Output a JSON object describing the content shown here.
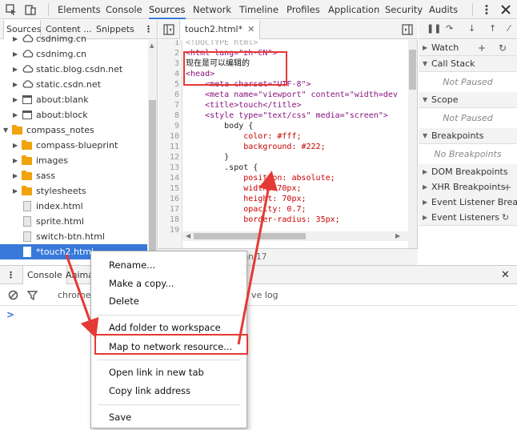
{
  "toolbar": {
    "tabs": [
      "Elements",
      "Console",
      "Sources",
      "Network",
      "Timeline",
      "Profiles",
      "Application",
      "Security",
      "Audits"
    ],
    "active_tab": "Sources"
  },
  "navigator": {
    "tabs": [
      "Sources",
      "Content ...",
      "Snippets"
    ],
    "items": [
      {
        "label": "csdnimg.cn",
        "kind": "cloud"
      },
      {
        "label": "csdnimg.cn",
        "kind": "cloud"
      },
      {
        "label": "static.blog.csdn.net",
        "kind": "cloud"
      },
      {
        "label": "static.csdn.net",
        "kind": "cloud"
      },
      {
        "label": "about:blank",
        "kind": "frame"
      },
      {
        "label": "about:block",
        "kind": "frame"
      },
      {
        "label": "compass_notes",
        "kind": "folder-open"
      },
      {
        "label": "compass-blueprint",
        "kind": "folder"
      },
      {
        "label": "images",
        "kind": "folder"
      },
      {
        "label": "sass",
        "kind": "folder"
      },
      {
        "label": "stylesheets",
        "kind": "folder"
      },
      {
        "label": "index.html",
        "kind": "file"
      },
      {
        "label": "sprite.html",
        "kind": "file"
      },
      {
        "label": "switch-btn.html",
        "kind": "file"
      },
      {
        "label": "*touch2.html",
        "kind": "file-selected"
      }
    ]
  },
  "editor": {
    "tab_label": "touch2.html*",
    "status": "Line 7, Column 17",
    "line_numbers": [
      "1",
      "2",
      "3",
      "4",
      "5",
      "6",
      "7",
      "8",
      "9",
      "10",
      "11",
      "12",
      "13",
      "14",
      "15",
      "16",
      "17",
      "18",
      "19"
    ],
    "lines": [
      "<!DOCTYPE html>",
      "<html lang=\"zh-CN\">",
      "现在是可以编辑的",
      "<head>",
      "    <meta charset=\"UTF-8\">",
      "    <meta name=\"viewport\" content=\"width=dev",
      "    <title>touch</title>",
      "    <style type=\"text/css\" media=\"screen\">",
      "        body {",
      "            color: #fff;",
      "            background: #222;",
      "        }",
      "        .spot {",
      "            position: absolute;",
      "            width: 70px;",
      "            height: 70px;",
      "            opacity: 0.7;",
      "            border-radius: 35px;",
      ""
    ]
  },
  "sidebar": {
    "panes": [
      {
        "title": "Watch",
        "body": ""
      },
      {
        "title": "Call Stack",
        "body": "Not Paused"
      },
      {
        "title": "Scope",
        "body": "Not Paused"
      },
      {
        "title": "Breakpoints",
        "body": "No Breakpoints"
      },
      {
        "title": "DOM Breakpoints",
        "body": ""
      },
      {
        "title": "XHR Breakpoints",
        "body": ""
      },
      {
        "title": "Event Listener Breakpoints",
        "body": ""
      },
      {
        "title": "Event Listeners",
        "body": ""
      }
    ]
  },
  "drawer": {
    "tabs": [
      "Console",
      "Anima"
    ],
    "filter_text": "chrome-",
    "log_text": "ve log",
    "prompt": ">"
  },
  "context_menu": {
    "items": [
      "Rename...",
      "Make a copy...",
      "Delete",
      "Add folder to workspace",
      "Map to network resource...",
      "Open link in new tab",
      "Copy link address",
      "Save"
    ]
  },
  "colors": {
    "accent": "#3879d9",
    "annotation": "#e53935",
    "folder": "#f0a30a"
  }
}
